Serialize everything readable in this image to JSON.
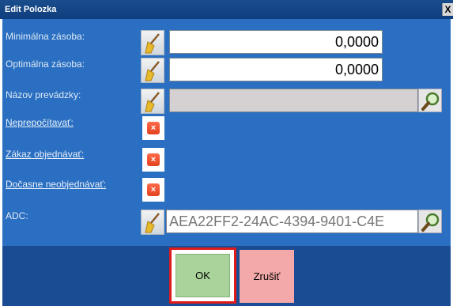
{
  "window": {
    "title": "Edit Polozka",
    "close_label": "X"
  },
  "fields": {
    "min_label": "Minimálna zásoba:",
    "min_value": "0,0000",
    "opt_label": "Optimálna zásoba:",
    "opt_value": "0,0000",
    "store_label": "Názov prevádzky:",
    "store_value": "",
    "noconv_label": "Neprepočítavať:",
    "noorder_label": "Zákaz objednávať:",
    "tmpnoorder_label": "Dočasne neobjednávať:",
    "adc_label": "ADC:",
    "adc_value": "AEA22FF2-24AC-4394-9401-C4E"
  },
  "checkbox_glyph": "×",
  "buttons": {
    "ok_label": "OK",
    "cancel_label": "Zrušiť"
  },
  "colors": {
    "panel": "#2a6fc1",
    "footer": "#1a4c93",
    "ok": "#a9d39a",
    "cancel": "#f3a9a9",
    "highlight": "#e01b1b"
  }
}
